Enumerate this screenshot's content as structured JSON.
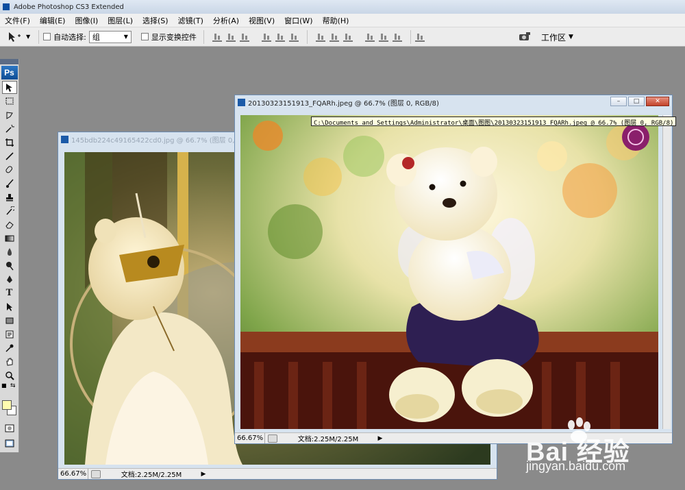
{
  "app": {
    "title": "Adobe Photoshop CS3 Extended"
  },
  "menu": [
    "文件(F)",
    "编辑(E)",
    "图像(I)",
    "图层(L)",
    "选择(S)",
    "滤镜(T)",
    "分析(A)",
    "视图(V)",
    "窗口(W)",
    "帮助(H)"
  ],
  "options": {
    "auto_select_label": "自动选择:",
    "auto_select_value": "组",
    "show_transform_label": "显示变换控件",
    "workspace_label": "工作区"
  },
  "toolbox": {
    "logo": "Ps",
    "colors": {
      "foreground": "#fffbb0",
      "background": "#ffffff"
    }
  },
  "doc_back": {
    "title": "145bdb224c49165422cd0.jpg @ 66.7% (图层 0, R",
    "zoom": "66.67%",
    "doc_size": "文档:2.25M/2.25M"
  },
  "doc_front": {
    "title": "20130323151913_FQARh.jpeg @ 66.7% (图层 0, RGB/8)",
    "zoom": "66.67%",
    "doc_size": "文档:2.25M/2.25M",
    "window_buttons": [
      "–",
      "□",
      "✕"
    ]
  },
  "tooltip": "C:\\Documents and Settings\\Administrator\\桌面\\图图\\20130323151913_FQARh.jpeg @ 66.7% (图层 0, RGB/8)",
  "watermark": {
    "brand": "Bai 经验",
    "url": "jingyan.baidu.com"
  }
}
